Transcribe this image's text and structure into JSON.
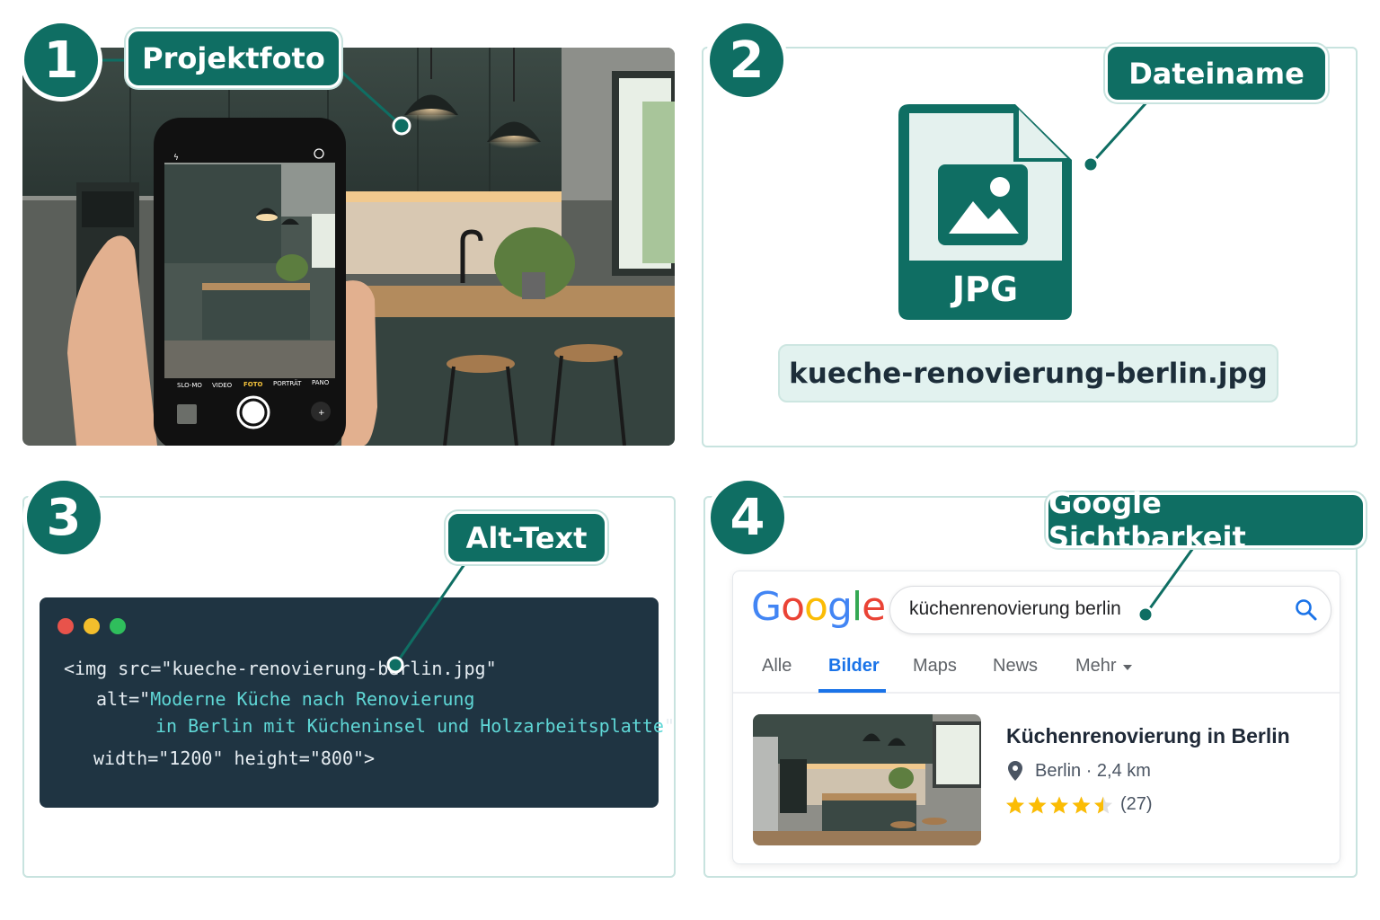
{
  "steps": [
    {
      "number": "1",
      "label": "Projektfoto"
    },
    {
      "number": "2",
      "label": "Dateiname"
    },
    {
      "number": "3",
      "label": "Alt-Text"
    },
    {
      "number": "4",
      "label": "Google Sichtbarkeit"
    }
  ],
  "camera": {
    "modes": [
      "SLO-MO",
      "VIDEO",
      "FOTO",
      "PORTRÄT",
      "PANO"
    ],
    "active_mode": "FOTO"
  },
  "file": {
    "type_label": "JPG",
    "filename": "kueche-renovierung-berlin.jpg"
  },
  "code": {
    "line1": "<img src=\"kueche-renovierung-berlin.jpg\"",
    "line2_attr": "alt=\"",
    "line2_value": "Moderne Küche nach Renovierung",
    "line3_value": "in Berlin mit Kücheninsel und Holzarbeitsplatte",
    "line3_end": "\"",
    "line4": "width=\"1200\" height=\"800\">"
  },
  "google": {
    "logo": "Google",
    "query": "küchenrenovierung berlin",
    "tabs": [
      "Alle",
      "Bilder",
      "Maps",
      "News",
      "Mehr"
    ],
    "active_tab": "Bilder",
    "result": {
      "title": "Küchenrenovierung in Berlin",
      "location": "Berlin · 2,4 km",
      "rating": 4.5,
      "reviews": "(27)"
    }
  },
  "colors": {
    "teal": "#0f6e63",
    "border": "#c8e3df",
    "code_bg": "#1f3442",
    "google_blue": "#1a73e8",
    "star": "#fbbc04"
  },
  "icons": [
    "image-file-icon",
    "search-icon",
    "location-pin-icon",
    "star-icon",
    "caret-down-icon"
  ]
}
